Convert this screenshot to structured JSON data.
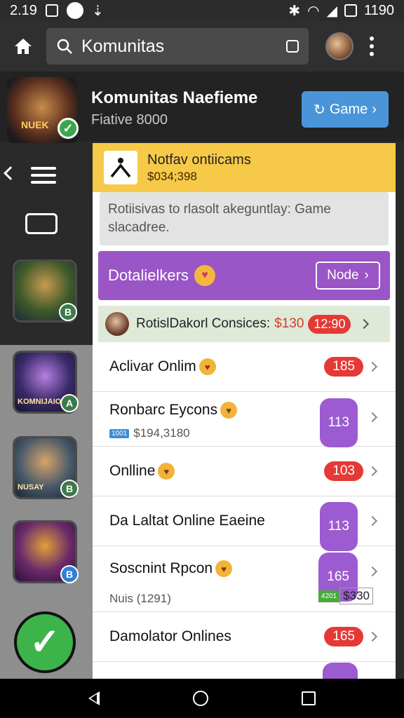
{
  "status": {
    "time": "2.19",
    "battery": "1190"
  },
  "appbar": {
    "search_text": "Komunitas"
  },
  "header": {
    "title": "Komunitas Naefieme",
    "subtitle": "Fiative 8000",
    "game_button": "Game",
    "logo_text": "NUEK"
  },
  "sidebar": {
    "tiles": [
      {
        "caption": "",
        "badge": "B"
      },
      {
        "caption": "KOMNIJAIO",
        "badge": "A"
      },
      {
        "caption": "NUSAY",
        "badge": "B"
      },
      {
        "caption": "",
        "badge": "B"
      }
    ]
  },
  "panel": {
    "notice": {
      "title": "Notfav ontiicams",
      "subtitle": "$034;398"
    },
    "description": "Rotiisivas to rlasolt akeguntlay: Game slacadree.",
    "promo": {
      "label": "Dotalielkers",
      "button": "Node"
    },
    "featured": {
      "name": "RotislDakorl Consices:",
      "price": "$130",
      "badge": "12:90"
    },
    "rows": [
      {
        "name": "Aclivar Onlim",
        "count": "185",
        "color": "red"
      },
      {
        "name": "Ronbarc Eycons",
        "count": "113",
        "color": "purple",
        "tag": "1001",
        "sub": "$194,3180"
      },
      {
        "name": "Onlline",
        "count": "103",
        "color": "red"
      },
      {
        "name": "Da Laltat Online Eaeine",
        "count": "113",
        "color": "purple"
      },
      {
        "name": "Soscnint Rpcon",
        "count": "165",
        "color": "purple",
        "sub": "Nuis (1291)",
        "green_tag": "4201",
        "green_value": "$330"
      },
      {
        "name": "Damolator Onlines",
        "count": "165",
        "color": "red"
      }
    ]
  },
  "colors": {
    "accent_yellow": "#f7c948",
    "accent_purple": "#9a55c6",
    "accent_blue": "#4a95d9",
    "badge_red": "#e53935"
  }
}
